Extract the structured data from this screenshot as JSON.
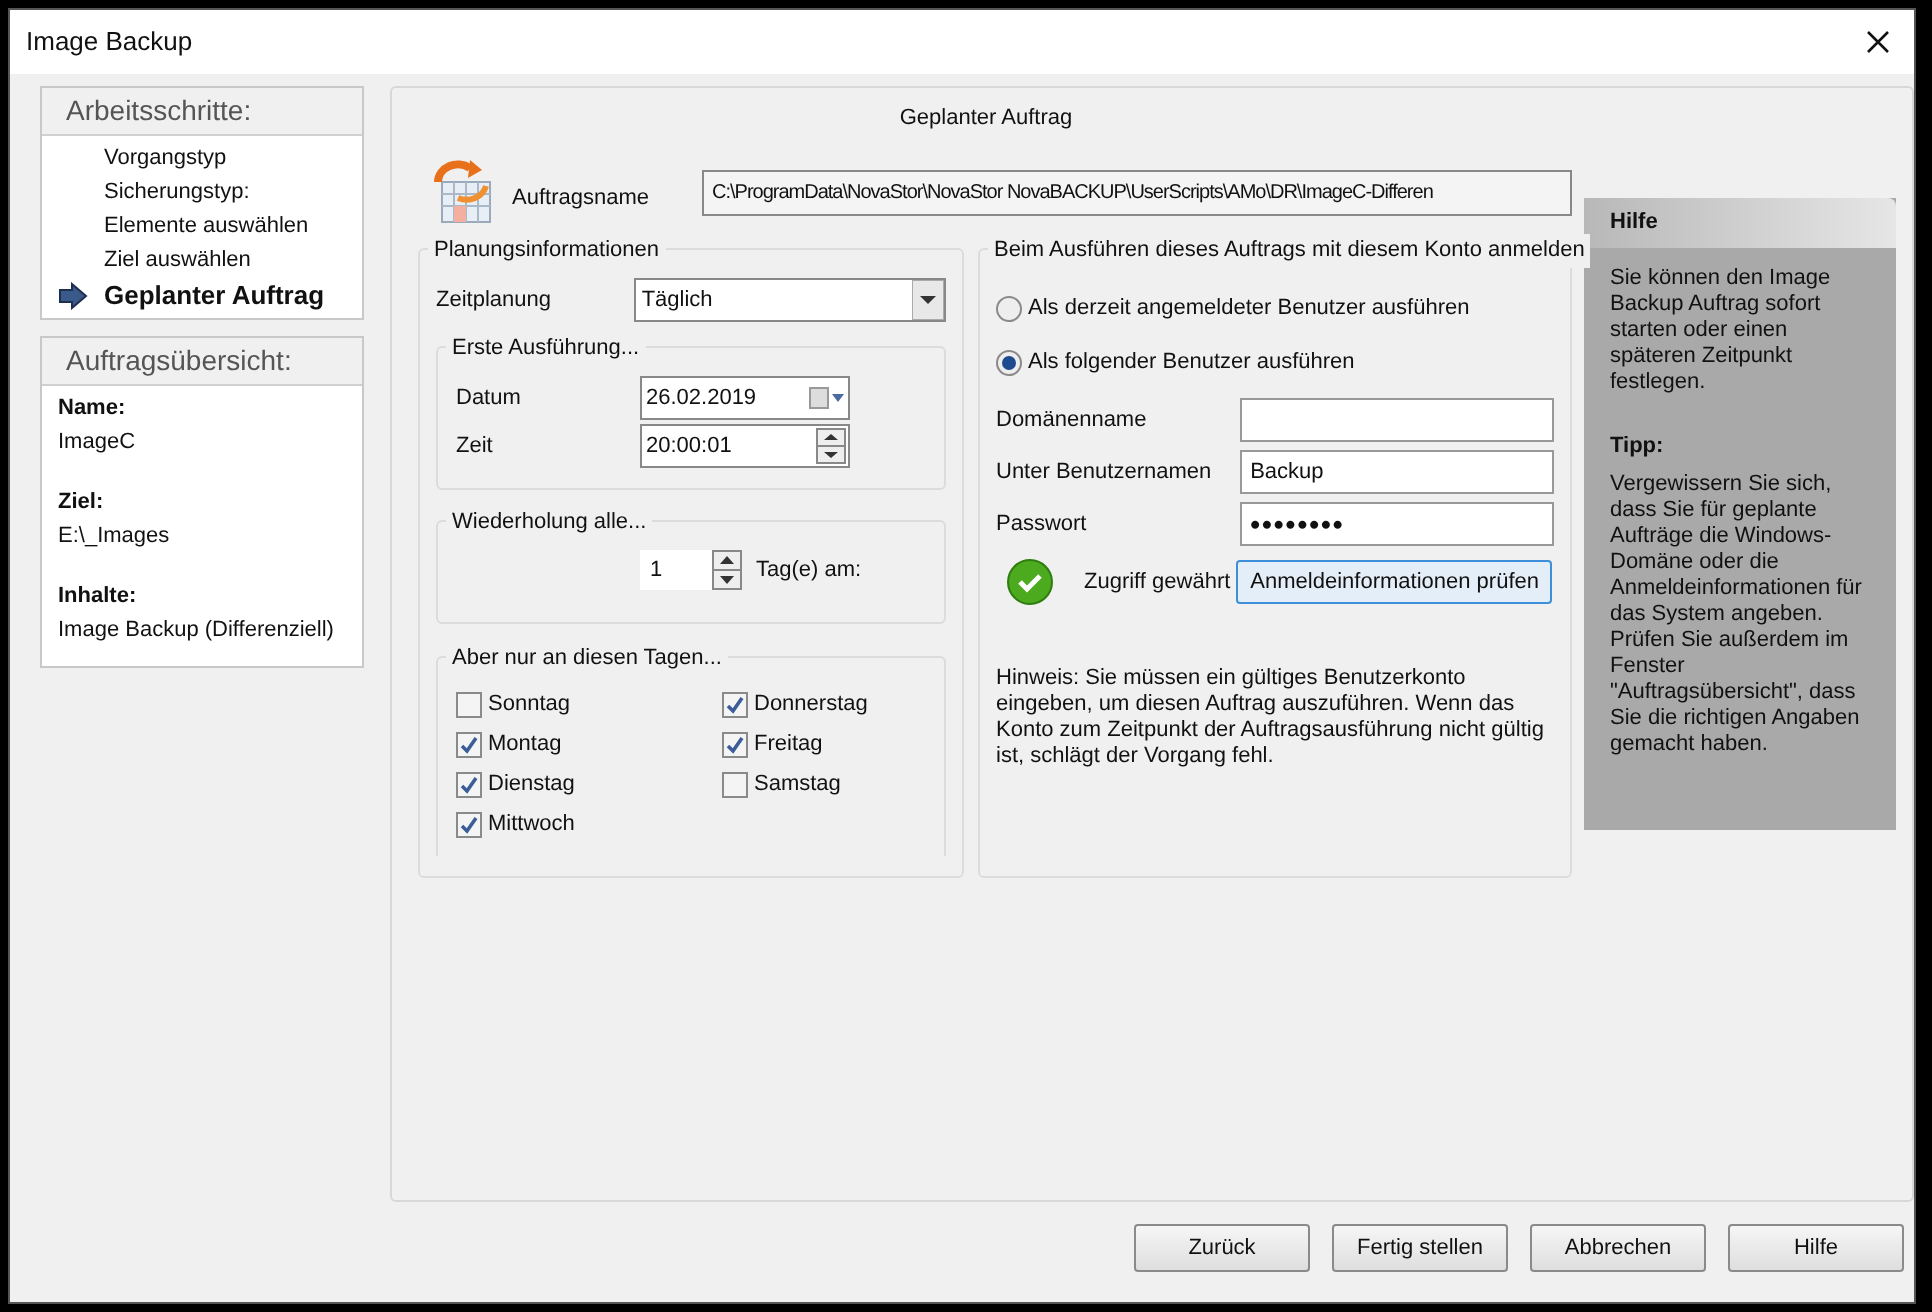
{
  "window": {
    "title": "Image Backup"
  },
  "steps": {
    "title": "Arbeitsschritte:",
    "items": [
      {
        "label": "Vorgangstyp",
        "current": false
      },
      {
        "label": "Sicherungstyp:",
        "current": false
      },
      {
        "label": "Elemente auswählen",
        "current": false
      },
      {
        "label": "Ziel auswählen",
        "current": false
      },
      {
        "label": "Geplanter Auftrag",
        "current": true
      }
    ]
  },
  "summary": {
    "title": "Auftragsübersicht:",
    "fields": [
      {
        "label": "Name:",
        "value": "ImageC"
      },
      {
        "label": "Ziel:",
        "value": "E:\\_Images"
      },
      {
        "label": "Inhalte:",
        "value": "Image Backup (Differenziell)"
      }
    ]
  },
  "page_title": "Geplanter Auftrag",
  "job_name": {
    "label": "Auftragsname",
    "value": "C:\\ProgramData\\NovaStor\\NovaStor NovaBACKUP\\UserScripts\\AMo\\DR\\ImageC-Differen"
  },
  "schedule": {
    "title": "Planungsinformationen",
    "label": "Zeitplanung",
    "value": "Täglich",
    "first_run": {
      "title": "Erste Ausführung...",
      "date_label": "Datum",
      "date": "26.02.2019",
      "time_label": "Zeit",
      "time": "20:00:01"
    },
    "repeat": {
      "title": "Wiederholung alle...",
      "value": "1",
      "unit": "Tag(e) am:"
    },
    "days": {
      "title": "Aber nur an diesen Tagen...",
      "items": [
        {
          "label": "Sonntag",
          "checked": false
        },
        {
          "label": "Montag",
          "checked": true
        },
        {
          "label": "Dienstag",
          "checked": true
        },
        {
          "label": "Mittwoch",
          "checked": true
        },
        {
          "label": "Donnerstag",
          "checked": true
        },
        {
          "label": "Freitag",
          "checked": true
        },
        {
          "label": "Samstag",
          "checked": false
        }
      ]
    }
  },
  "account": {
    "title": "Beim Ausführen dieses Auftrags mit diesem Konto anmelden",
    "options": [
      {
        "label": "Als derzeit angemeldeter Benutzer ausführen",
        "selected": false
      },
      {
        "label": "Als folgender Benutzer ausführen",
        "selected": true
      }
    ],
    "fields": [
      {
        "label": "Domänenname",
        "kind": "text"
      },
      {
        "label": "Unter Benutzernamen",
        "kind": "text",
        "value": "Backup"
      },
      {
        "label": "Passwort",
        "kind": "password",
        "value": "••••••••"
      }
    ],
    "status": "Zugriff gewährt",
    "check_button": "Anmeldeinformationen prüfen",
    "note": "Hinweis: Sie müssen ein gültiges Benutzerkonto eingeben, um diesen Auftrag auszuführen. Wenn das Konto zum Zeitpunkt der Auftragsausführung nicht gültig ist, schlägt der Vorgang fehl."
  },
  "help": {
    "title": "Hilfe",
    "text": "Sie können den Image Backup Auftrag sofort starten oder einen späteren Zeitpunkt festlegen.",
    "tip_title": "Tipp:",
    "tip_text": "Vergewissern Sie sich, dass Sie für geplante Aufträge die Windows-Domäne oder die Anmeldeinformationen für das System angeben. Prüfen Sie außerdem im Fenster \"Auftragsübersicht\", dass Sie die richtigen Angaben gemacht haben."
  },
  "buttons": [
    "Zurück",
    "Fertig stellen",
    "Abbrechen",
    "Hilfe"
  ]
}
